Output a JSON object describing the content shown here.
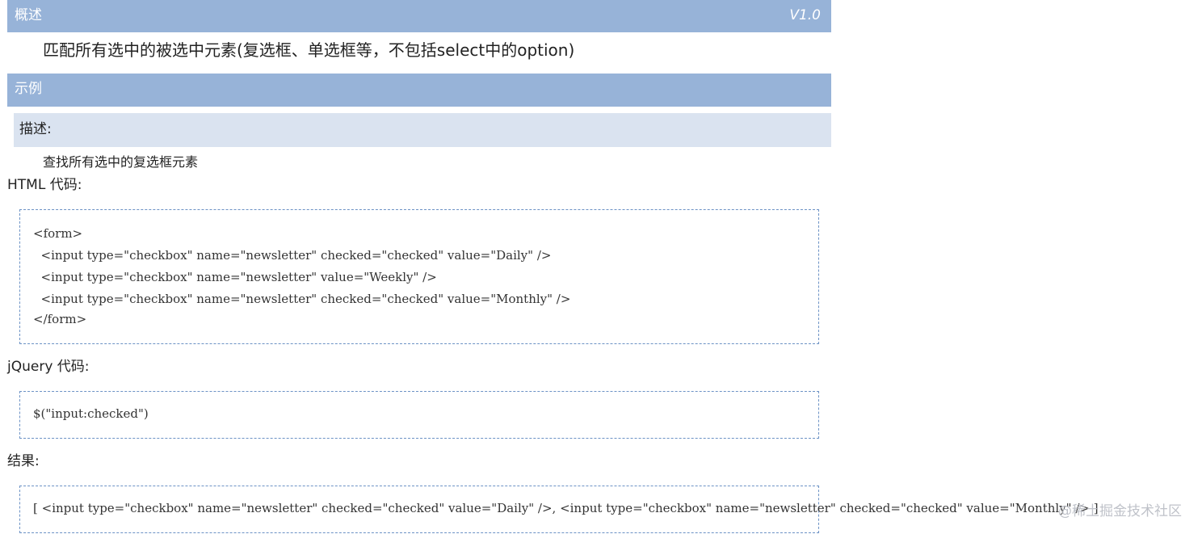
{
  "header": {
    "title": "概述",
    "version": "V1.0"
  },
  "summary": "匹配所有选中的被选中元素(复选框、单选框等，不包括select中的option)",
  "example": {
    "title": "示例",
    "desc_label": "描述:",
    "desc_text": "查找所有选中的复选框元素"
  },
  "html_code": {
    "label": "HTML 代码:",
    "lines": [
      "<form>",
      "  <input type=\"checkbox\" name=\"newsletter\" checked=\"checked\" value=\"Daily\" />",
      "  <input type=\"checkbox\" name=\"newsletter\" value=\"Weekly\" />",
      "  <input type=\"checkbox\" name=\"newsletter\" checked=\"checked\" value=\"Monthly\" />",
      "</form>"
    ]
  },
  "jquery_code": {
    "label": "jQuery 代码:",
    "line": "$(\"input:checked\")"
  },
  "result": {
    "label": "结果:",
    "line": "[ <input type=\"checkbox\" name=\"newsletter\" checked=\"checked\" value=\"Daily\" />, <input type=\"checkbox\" name=\"newsletter\" checked=\"checked\" value=\"Monthly\" /> ]"
  },
  "watermark": "@稀土掘金技术社区",
  "colors": {
    "header_bar": "#97b3d8",
    "sub_bar": "#dae3f0",
    "code_border": "#6c92c5"
  }
}
